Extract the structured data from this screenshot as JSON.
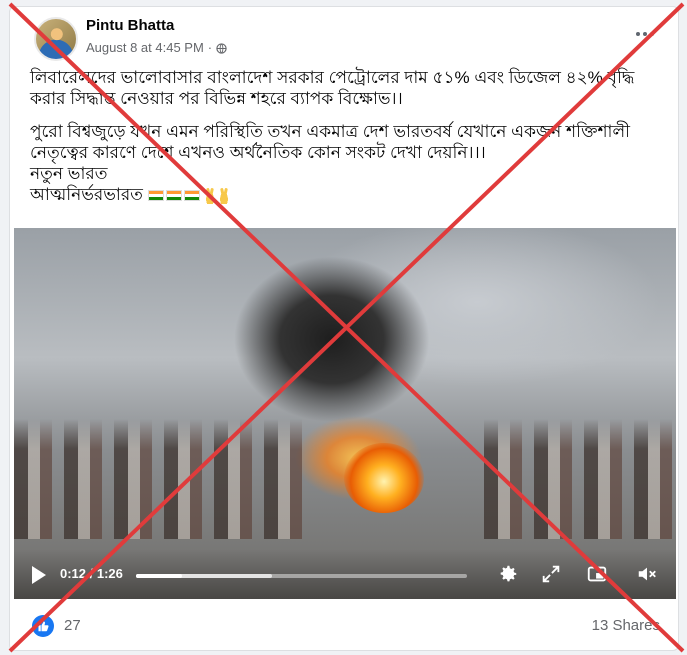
{
  "post": {
    "author": "Pintu Bhatta",
    "date": "August 8 at 4:45 PM",
    "separator": "·",
    "paragraph1": "লিবারেলদের ভালোবাসার বাংলাদেশ সরকার পেট্রোলের দাম ৫১% এবং ডিজেল ৪২% বৃদ্ধি করার সিদ্ধান্ত নেওয়ার পর বিভিন্ন শহরে ব্যাপক বিক্ষোভ।।",
    "paragraph2_line1": "পুরো বিশ্বজুড়ে যখন এমন পরিস্থিতি তখন একমাত্র দেশ ভারতবর্ষ যেখানে একজন শক্তিশালী নেতৃত্বের কারণে দেশে এখনও অর্থনৈতিক কোন সংকট দেখা দেয়নি।।।",
    "paragraph2_line2": "নতুন ভারত",
    "paragraph2_line3": "আত্মনির্ভরভারত"
  },
  "video": {
    "current_time": "0:12",
    "duration": "1:26",
    "time_separator": " / ",
    "progress_fraction": 0.14,
    "buffered_fraction": 0.41
  },
  "footer": {
    "reactions_count": "27",
    "shares_label": "13 Shares"
  },
  "colors": {
    "accent": "#1877f2",
    "overlay_x": "#e03b3b"
  },
  "icons": [
    "globe-icon",
    "more-options-icon",
    "play-icon",
    "settings-icon",
    "fullscreen-icon",
    "pip-icon",
    "mute-icon",
    "like-icon"
  ]
}
